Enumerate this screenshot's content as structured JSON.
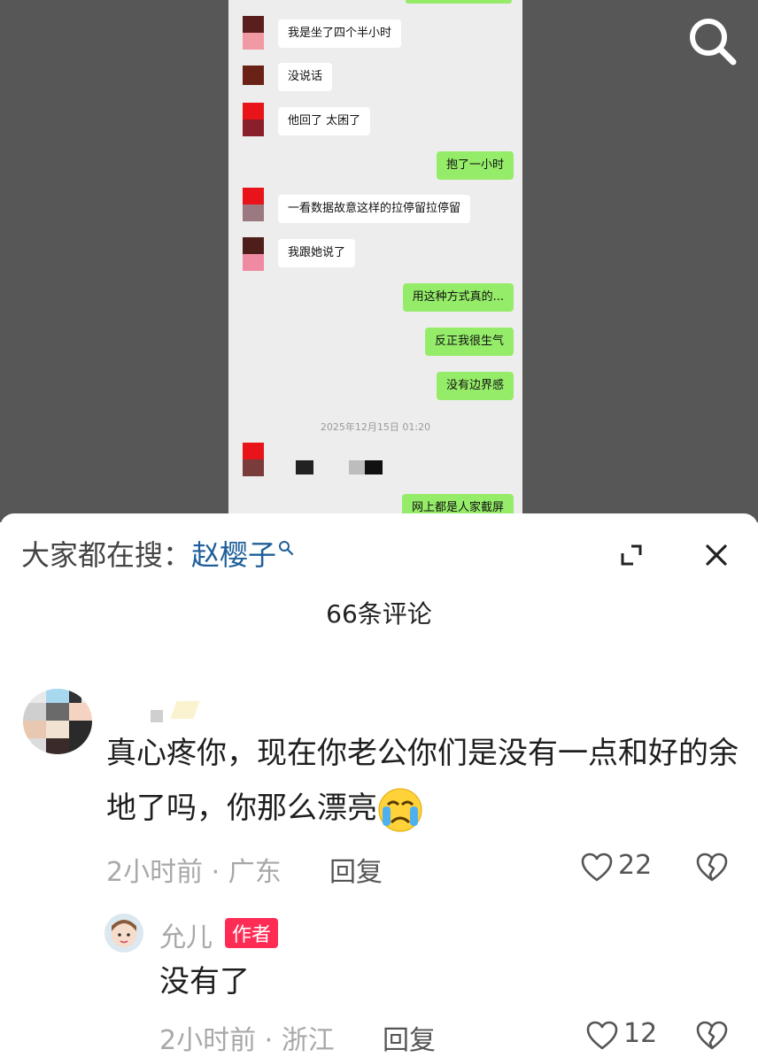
{
  "chat": {
    "messages": [
      {
        "side": "left",
        "text": "我是坐了四个半小时"
      },
      {
        "side": "left",
        "text": "没说话"
      },
      {
        "side": "left",
        "text": "他回了 太困了"
      },
      {
        "side": "right",
        "text": "抱了一小时"
      },
      {
        "side": "left",
        "text": "一看数据故意这样的拉停留拉停留"
      },
      {
        "side": "left",
        "text": "我跟她说了"
      },
      {
        "side": "right",
        "text": "用这种方式真的..."
      },
      {
        "side": "right",
        "text": "反正我很生气"
      },
      {
        "side": "right",
        "text": "没有边界感"
      },
      {
        "side": "right",
        "text": "网上都是人家截屏"
      }
    ],
    "timestamp": "2025年12月15日 01:20"
  },
  "search": {
    "hot_prefix": "大家都在搜：",
    "hot_keyword": "赵樱子"
  },
  "icons": {
    "search": "search-icon",
    "expand": "expand-icon",
    "close": "close-icon",
    "like": "heart-icon",
    "dislike": "broken-heart-icon",
    "cry_emoji": "crying-face-emoji"
  },
  "comments": {
    "count_label": "66条评论",
    "items": [
      {
        "text": "真心疼你，现在你老公你们是没有一点和好的余地了吗，你那么漂亮",
        "time": "2小时前",
        "location": "广东",
        "reply_label": "回复",
        "likes": "22"
      }
    ],
    "reply": {
      "name": "允儿",
      "badge": "作者",
      "text": "没有了",
      "time": "2小时前",
      "location": "浙江",
      "reply_label": "回复",
      "likes": "12"
    }
  },
  "colors": {
    "green_bubble": "#95ec69",
    "keyword_blue": "#1f5f99",
    "author_badge": "#fe2c55"
  }
}
